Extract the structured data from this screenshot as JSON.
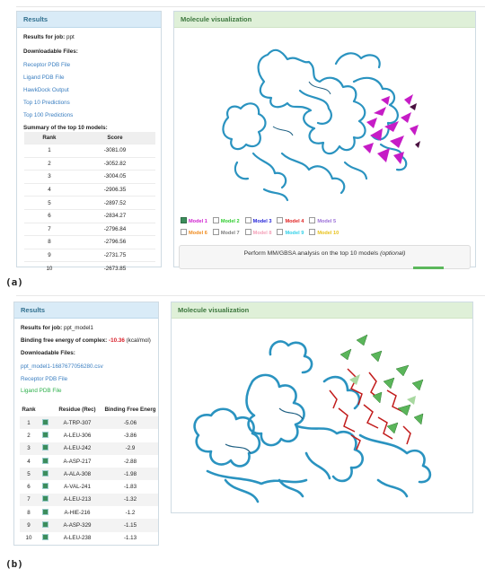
{
  "panel_a": {
    "results": {
      "header": "Results",
      "results_for_job_label": "Results for job:",
      "job_name": "ppt",
      "downloadable_files_label": "Downloadable Files:",
      "links": [
        "Receptor PDB File",
        "Ligand PDB File",
        "HawkDock Output",
        "Top 10 Predictions",
        "Top 100 Predictions"
      ],
      "summary_label": "Summary of the top 10 models:",
      "table": {
        "headers": [
          "Rank",
          "Score"
        ],
        "rows": [
          [
            "1",
            "-3081.09"
          ],
          [
            "2",
            "-3052.82"
          ],
          [
            "3",
            "-3004.05"
          ],
          [
            "4",
            "-2906.35"
          ],
          [
            "5",
            "-2897.52"
          ],
          [
            "6",
            "-2834.27"
          ],
          [
            "7",
            "-2796.84"
          ],
          [
            "8",
            "-2796.56"
          ],
          [
            "9",
            "-2731.75"
          ],
          [
            "10",
            "-2673.85"
          ]
        ]
      }
    },
    "viz": {
      "header": "Molecule visualization",
      "models": [
        {
          "label": "Model 1",
          "color": "#d01fd0",
          "checked": true
        },
        {
          "label": "Model 2",
          "color": "#2ecc2e",
          "checked": false
        },
        {
          "label": "Model 3",
          "color": "#1f1fd8",
          "checked": false
        },
        {
          "label": "Model 4",
          "color": "#e02020",
          "checked": false
        },
        {
          "label": "Model 5",
          "color": "#9b6fd8",
          "checked": false
        },
        {
          "label": "Model 6",
          "color": "#f08a1c",
          "checked": false
        },
        {
          "label": "Model 7",
          "color": "#7d7d7d",
          "checked": false
        },
        {
          "label": "Model 8",
          "color": "#f4a0b8",
          "checked": false
        },
        {
          "label": "Model 9",
          "color": "#2fd0e8",
          "checked": false
        },
        {
          "label": "Model 10",
          "color": "#e8c21c",
          "checked": false
        }
      ],
      "mmgbsa_text": "Perform MM/GBSA analysis on the top 10 models",
      "mmgbsa_optional": "(optional)"
    },
    "caption": "(a)"
  },
  "panel_b": {
    "results": {
      "header": "Results",
      "results_for_job_label": "Results for job:",
      "job_name": "ppt_model1",
      "binding_label": "Binding free energy of complex:",
      "binding_value": "-10.36",
      "binding_unit": "(kcal/mol)",
      "downloadable_files_label": "Downloadable Files:",
      "csv_link": "ppt_model1-1687677056280.csv",
      "receptor_link": "Receptor PDB File",
      "ligand_link": "Ligand PDB File",
      "table": {
        "headers": [
          "Rank",
          "",
          "Residue (Rec)",
          "Binding Free Energ"
        ],
        "rows": [
          [
            "1",
            "A-TRP-307",
            "-5.06"
          ],
          [
            "2",
            "A-LEU-306",
            "-3.86"
          ],
          [
            "3",
            "A-LEU-242",
            "-2.9"
          ],
          [
            "4",
            "A-ASP-217",
            "-2.88"
          ],
          [
            "5",
            "A-ALA-308",
            "-1.98"
          ],
          [
            "6",
            "A-VAL-241",
            "-1.83"
          ],
          [
            "7",
            "A-LEU-213",
            "-1.32"
          ],
          [
            "8",
            "A-HIE-216",
            "-1.2"
          ],
          [
            "9",
            "A-ASP-329",
            "-1.15"
          ],
          [
            "10",
            "A-LEU-238",
            "-1.13"
          ]
        ]
      }
    },
    "viz": {
      "header": "Molecule visualization"
    },
    "caption": "(b)"
  }
}
